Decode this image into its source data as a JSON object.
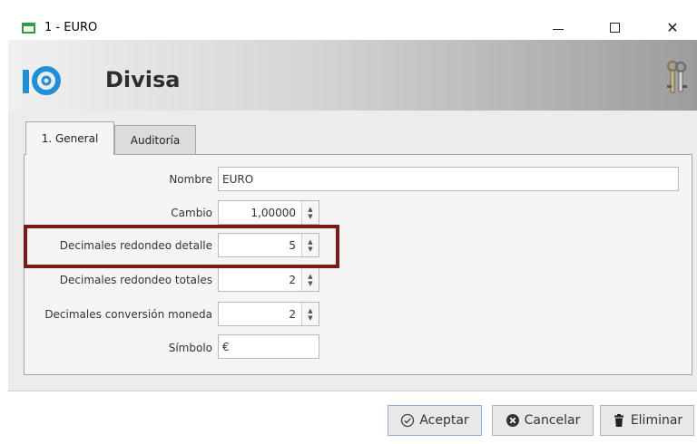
{
  "window": {
    "title": "1 - EURO"
  },
  "header": {
    "title": "Divisa"
  },
  "tabs": [
    {
      "label": "1. General",
      "active": true
    },
    {
      "label": "Auditoría",
      "active": false
    }
  ],
  "form": {
    "nombre": {
      "label": "Nombre",
      "value": "EURO"
    },
    "cambio": {
      "label": "Cambio",
      "value": "1,00000"
    },
    "dec_detalle": {
      "label": "Decimales redondeo detalle",
      "value": "5"
    },
    "dec_totales": {
      "label": "Decimales redondeo totales",
      "value": "2"
    },
    "dec_conversion": {
      "label": "Decimales conversión moneda",
      "value": "2"
    },
    "simbolo": {
      "label": "Símbolo",
      "value": "€"
    }
  },
  "buttons": {
    "accept": "Aceptar",
    "cancel": "Cancelar",
    "delete": "Eliminar"
  },
  "colors": {
    "highlight": "#7a1a1a",
    "logo": "#1f8fd6",
    "window_icon": "#2f9e3f"
  }
}
